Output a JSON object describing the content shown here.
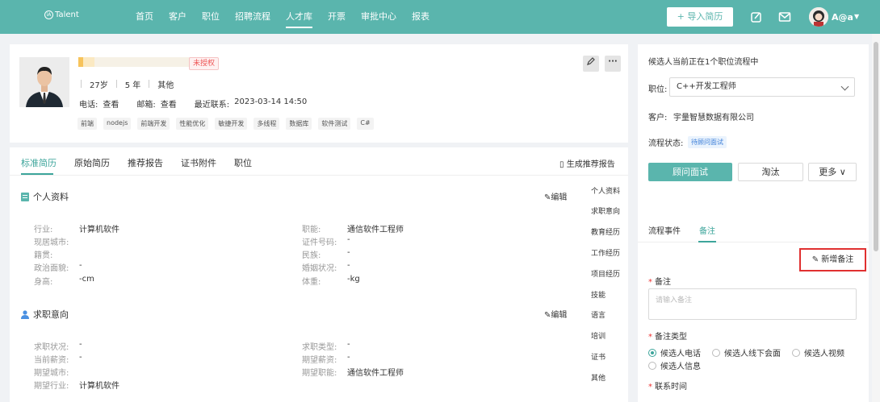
{
  "topbar": {
    "logo_text": "Talent",
    "logo_mark": "iA",
    "nav": [
      "首页",
      "客户",
      "职位",
      "招聘流程",
      "人才库",
      "开票",
      "审批中心",
      "报表"
    ],
    "active_index": 4,
    "import_button": "+ 导入简历",
    "user_name": "A@a"
  },
  "profile": {
    "unauthorized_tag": "未授权",
    "age": "27岁",
    "experience": "5 年",
    "education": "其他",
    "phone_label": "电话:",
    "phone_action": "查看",
    "email_label": "邮箱:",
    "email_action": "查看",
    "last_contact_label": "最近联系:",
    "last_contact_value": "2023-03-14 14:50",
    "skills": [
      "前端",
      "nodejs",
      "前端开发",
      "性能优化",
      "敏捷开发",
      "多线程",
      "数据库",
      "软件测试",
      "C#"
    ]
  },
  "resume": {
    "tabs": [
      "标准简历",
      "原始简历",
      "推荐报告",
      "证书附件",
      "职位"
    ],
    "generate_report": "生成推荐报告",
    "personal_title": "个人资料",
    "edit_label": "编辑",
    "personal_left": [
      {
        "label": "行业:",
        "value": "计算机软件"
      },
      {
        "label": "现居城市:",
        "value": ""
      },
      {
        "label": "籍贯:",
        "value": ""
      },
      {
        "label": "政治面貌:",
        "value": "-"
      },
      {
        "label": "身高:",
        "value": "-cm"
      }
    ],
    "personal_right": [
      {
        "label": "职能:",
        "value": "通信软件工程师"
      },
      {
        "label": "证件号码:",
        "value": "-"
      },
      {
        "label": "民族:",
        "value": "-"
      },
      {
        "label": "婚姻状况:",
        "value": "-"
      },
      {
        "label": "体重:",
        "value": "-kg"
      }
    ],
    "intent_title": "求职意向",
    "intent_left": [
      {
        "label": "求职状况:",
        "value": "-"
      },
      {
        "label": "当前薪资:",
        "value": "-"
      },
      {
        "label": "期望城市:",
        "value": ""
      },
      {
        "label": "期望行业:",
        "value": "计算机软件"
      }
    ],
    "intent_right": [
      {
        "label": "求职类型:",
        "value": "-"
      },
      {
        "label": "期望薪资:",
        "value": "-"
      },
      {
        "label": "期望职能:",
        "value": "通信软件工程师"
      }
    ],
    "anchors": [
      "个人资料",
      "求职意向",
      "教育经历",
      "工作经历",
      "项目经历",
      "技能",
      "语言",
      "培训",
      "证书",
      "其他"
    ]
  },
  "process": {
    "summary": "候选人当前正在1个职位流程中",
    "position_label": "职位:",
    "position_value": "C++开发工程师",
    "client_label": "客户:",
    "client_value": "宇量智慧数据有限公司",
    "status_label": "流程状态:",
    "status_value": "待顾问面试",
    "btn_interview": "顾问面试",
    "btn_reject": "淘汰",
    "btn_more": "更多",
    "tabs": [
      "流程事件",
      "备注"
    ],
    "add_note": "新增备注",
    "note_label": "备注",
    "note_placeholder": "请输入备注",
    "note_type_label": "备注类型",
    "note_types": [
      "候选人电话",
      "候选人线下会面",
      "候选人视频",
      "候选人信息"
    ],
    "contact_time_label": "联系时间"
  }
}
